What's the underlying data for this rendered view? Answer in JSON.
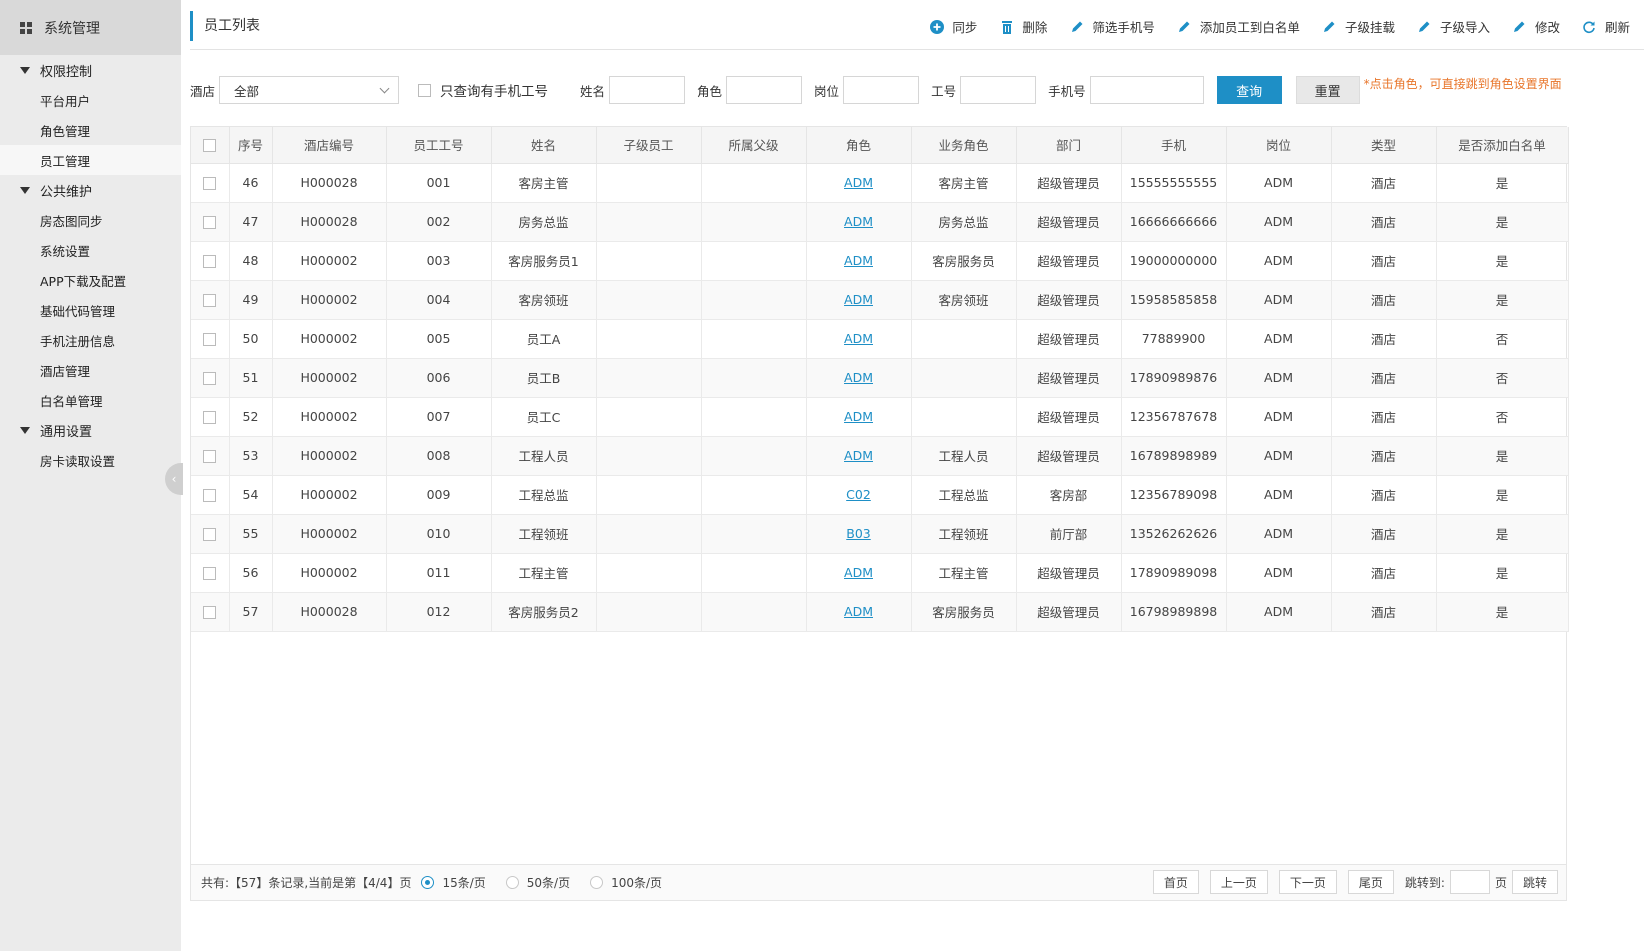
{
  "sidebar": {
    "header": "系统管理",
    "groups": [
      {
        "label": "权限控制",
        "items": [
          "平台用户",
          "角色管理",
          "员工管理"
        ]
      },
      {
        "label": "公共维护",
        "items": [
          "房态图同步",
          "系统设置",
          "APP下载及配置",
          "基础代码管理",
          "手机注册信息",
          "酒店管理",
          "白名单管理"
        ]
      },
      {
        "label": "通用设置",
        "items": [
          "房卡读取设置"
        ]
      }
    ],
    "active_item": "员工管理"
  },
  "header": {
    "title": "员工列表",
    "toolbar": [
      {
        "label": "同步",
        "icon": "plus-circle-icon"
      },
      {
        "label": "删除",
        "icon": "trash-icon"
      },
      {
        "label": "筛选手机号",
        "icon": "pencil-icon"
      },
      {
        "label": "添加员工到白名单",
        "icon": "pencil-icon"
      },
      {
        "label": "子级挂载",
        "icon": "pencil-icon"
      },
      {
        "label": "子级导入",
        "icon": "pencil-icon"
      },
      {
        "label": "修改",
        "icon": "pencil-icon"
      },
      {
        "label": "刷新",
        "icon": "refresh-icon"
      }
    ],
    "accent_color": "#1e8fc6"
  },
  "filters": {
    "hotel_label": "酒店",
    "hotel_value": "全部",
    "phone_only_label": "只查询有手机工号",
    "name_label": "姓名",
    "role_label": "角色",
    "post_label": "岗位",
    "staff_no_label": "工号",
    "phone_label": "手机号",
    "query_button": "查询",
    "reset_button": "重置",
    "hint": "*点击角色，可直接跳到角色设置界面"
  },
  "table": {
    "columns": [
      "序号",
      "酒店编号",
      "员工工号",
      "姓名",
      "子级员工",
      "所属父级",
      "角色",
      "业务角色",
      "部门",
      "手机",
      "岗位",
      "类型",
      "是否添加白名单"
    ],
    "rows": [
      [
        "46",
        "H000028",
        "001",
        "客房主管",
        "",
        "",
        "ADM",
        "客房主管",
        "超级管理员",
        "15555555555",
        "ADM",
        "酒店",
        "是"
      ],
      [
        "47",
        "H000028",
        "002",
        "房务总监",
        "",
        "",
        "ADM",
        "房务总监",
        "超级管理员",
        "16666666666",
        "ADM",
        "酒店",
        "是"
      ],
      [
        "48",
        "H000002",
        "003",
        "客房服务员1",
        "",
        "",
        "ADM",
        "客房服务员",
        "超级管理员",
        "19000000000",
        "ADM",
        "酒店",
        "是"
      ],
      [
        "49",
        "H000002",
        "004",
        "客房领班",
        "",
        "",
        "ADM",
        "客房领班",
        "超级管理员",
        "15958585858",
        "ADM",
        "酒店",
        "是"
      ],
      [
        "50",
        "H000002",
        "005",
        "员工A",
        "",
        "",
        "ADM",
        "",
        "超级管理员",
        "77889900",
        "ADM",
        "酒店",
        "否"
      ],
      [
        "51",
        "H000002",
        "006",
        "员工B",
        "",
        "",
        "ADM",
        "",
        "超级管理员",
        "17890989876",
        "ADM",
        "酒店",
        "否"
      ],
      [
        "52",
        "H000002",
        "007",
        "员工C",
        "",
        "",
        "ADM",
        "",
        "超级管理员",
        "12356787678",
        "ADM",
        "酒店",
        "否"
      ],
      [
        "53",
        "H000002",
        "008",
        "工程人员",
        "",
        "",
        "ADM",
        "工程人员",
        "超级管理员",
        "16789898989",
        "ADM",
        "酒店",
        "是"
      ],
      [
        "54",
        "H000002",
        "009",
        "工程总监",
        "",
        "",
        "C02",
        "工程总监",
        "客房部",
        "12356789098",
        "ADM",
        "酒店",
        "是"
      ],
      [
        "55",
        "H000002",
        "010",
        "工程领班",
        "",
        "",
        "B03",
        "工程领班",
        "前厅部",
        "13526262626",
        "ADM",
        "酒店",
        "是"
      ],
      [
        "56",
        "H000002",
        "011",
        "工程主管",
        "",
        "",
        "ADM",
        "工程主管",
        "超级管理员",
        "17890989098",
        "ADM",
        "酒店",
        "是"
      ],
      [
        "57",
        "H000028",
        "012",
        "客房服务员2",
        "",
        "",
        "ADM",
        "客房服务员",
        "超级管理员",
        "16798989898",
        "ADM",
        "酒店",
        "是"
      ]
    ]
  },
  "pagination": {
    "info": "共有:【57】条记录,当前是第【4/4】页",
    "page_sizes": [
      "15条/页",
      "50条/页",
      "100条/页"
    ],
    "selected_size": "15条/页",
    "first": "首页",
    "prev": "上一页",
    "next": "下一页",
    "last": "尾页",
    "jump_label": "跳转到:",
    "page_unit": "页",
    "jump_button": "跳转"
  }
}
